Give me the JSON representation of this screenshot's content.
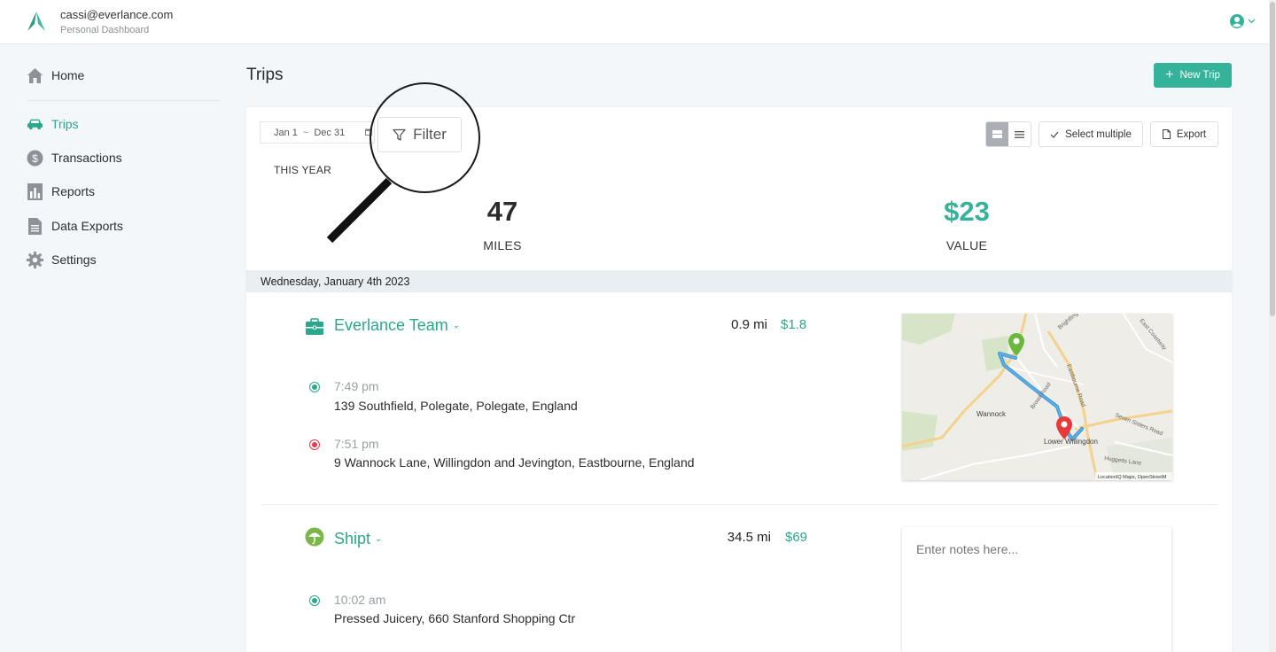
{
  "header": {
    "email": "cassi@everlance.com",
    "subtitle": "Personal Dashboard",
    "logo_icon": "everlance-logo-icon",
    "account_icon": "user-circle-icon"
  },
  "sidebar": {
    "items": [
      {
        "label": "Home",
        "icon": "home-icon"
      },
      {
        "label": "Trips",
        "icon": "car-icon",
        "active": true
      },
      {
        "label": "Transactions",
        "icon": "dollar-icon"
      },
      {
        "label": "Reports",
        "icon": "bar-chart-icon"
      },
      {
        "label": "Data Exports",
        "icon": "document-icon"
      },
      {
        "label": "Settings",
        "icon": "gear-icon"
      }
    ]
  },
  "page": {
    "title": "Trips",
    "new_trip_label": "New Trip"
  },
  "toolbar": {
    "date_from": "Jan 1",
    "date_sep": "~",
    "date_to": "Dec 31",
    "filter_label": "Filter",
    "select_multiple_label": "Select multiple",
    "export_label": "Export"
  },
  "summary": {
    "period": "THIS YEAR",
    "miles_value": "47",
    "miles_label": "MILES",
    "value_value": "$23",
    "value_label": "VALUE"
  },
  "day": {
    "date": "Wednesday, January 4th 2023"
  },
  "trips": [
    {
      "name": "Everlance Team",
      "distance": "0.9 mi",
      "value": "$1.8",
      "icon": "briefcase-icon",
      "stops": [
        {
          "time": "7:49 pm",
          "address": "139 Southfield, Polegate, Polegate, England"
        },
        {
          "time": "7:51 pm",
          "address": "9 Wannock Lane, Willingdon and Jevington, Eastbourne, England"
        }
      ],
      "map": {
        "labels": [
          "Wannock",
          "Lower Willingdon",
          "Eastbourne Road",
          "Broad Road",
          "Brightling Road",
          "East Coastway",
          "Seven Sisters Road",
          "Huggetts Lane"
        ],
        "attribution": "LocationIQ Maps, OpenStreetM"
      }
    },
    {
      "name": "Shipt",
      "distance": "34.5 mi",
      "value": "$69",
      "icon": "shipt-umbrella-icon",
      "stops": [
        {
          "time": "10:02 am",
          "address": "Pressed Juicery, 660 Stanford Shopping Ctr"
        }
      ],
      "notes_placeholder": "Enter notes here..."
    }
  ],
  "colors": {
    "accent": "#34b39a",
    "start_dot": "#2aa88e",
    "end_dot": "#e8394f"
  }
}
